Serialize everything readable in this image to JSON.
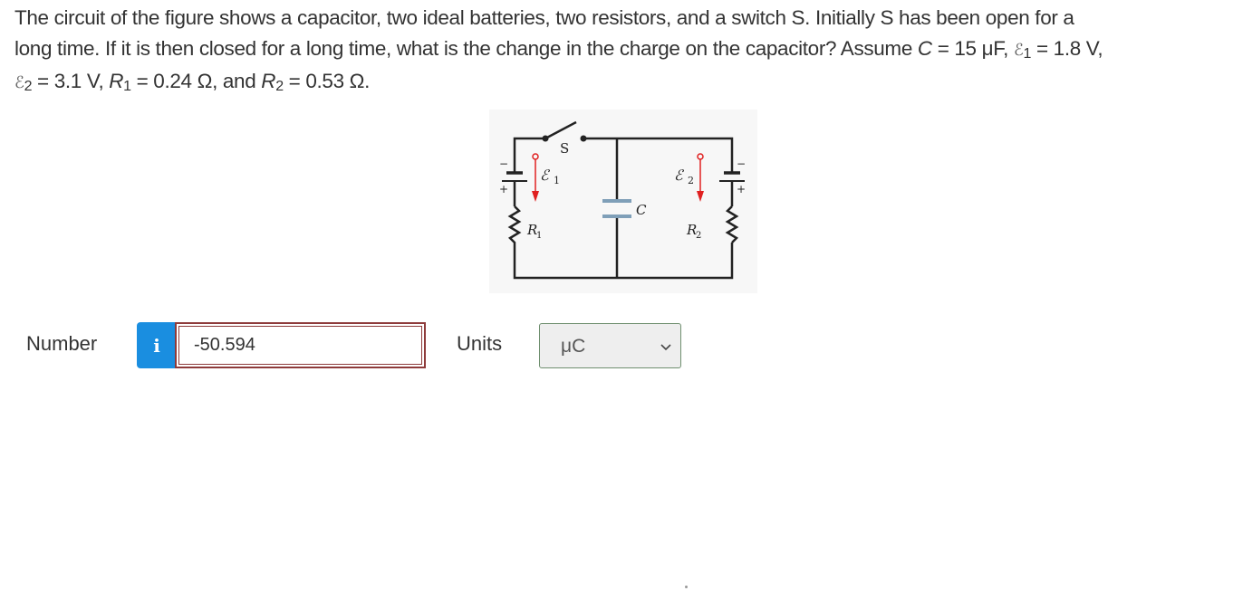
{
  "question": {
    "line1": "The circuit of the figure shows a capacitor, two ideal batteries, two resistors, and a switch S. Initially S has been open for a",
    "line2a": "long time. If it is then closed for a long time, what is the change in the charge on the capacitor? Assume ",
    "C_sym": "C",
    "C_val": " = 15 μF, ",
    "emf_sym": "ℰ",
    "emf1_sub": "1",
    "emf1_val": " = 1.8 V,",
    "emf2_sub": "2",
    "emf2_val": " = 3.1 V, ",
    "R_sym": "R",
    "R1_sub": "1",
    "R1_val": " = 0.24 Ω, and ",
    "R2_sub": "2",
    "R2_val": " = 0.53 Ω."
  },
  "figure": {
    "switch_label": "S",
    "emf1_label": "ℰ",
    "emf1_sub": "1",
    "emf2_label": "ℰ",
    "emf2_sub": "2",
    "capacitor_label": "C",
    "r1_label": "R",
    "r1_sub": "1",
    "r2_label": "R",
    "r2_sub": "2",
    "minus": "−",
    "plus": "+",
    "colors": {
      "wire": "#222222",
      "arrow": "#e02020",
      "capacitor": "#7f9fb8"
    }
  },
  "answer": {
    "number_label": "Number",
    "info_icon": "i",
    "number_value": "-50.594",
    "units_label": "Units",
    "units_selected": "μC"
  },
  "colors": {
    "info_button": "#1a8ee0",
    "input_border_error": "#8e3b3b",
    "select_border": "#6f8f6f",
    "select_bg": "#eeeeee"
  }
}
